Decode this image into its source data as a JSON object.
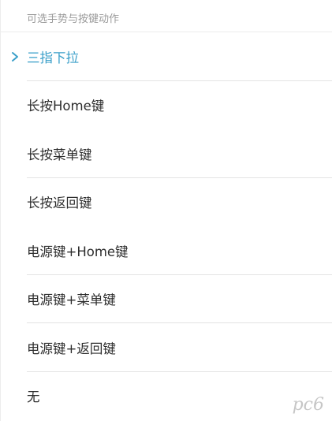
{
  "header": {
    "title": "可选手势与按键动作"
  },
  "options": [
    {
      "label": "三指下拉",
      "selected": true
    },
    {
      "label": "长按Home键",
      "selected": false
    },
    {
      "label": "长按菜单键",
      "selected": false
    },
    {
      "label": "长按返回键",
      "selected": false
    },
    {
      "label": "电源键+Home键",
      "selected": false
    },
    {
      "label": "电源键+菜单键",
      "selected": false
    },
    {
      "label": "电源键+返回键",
      "selected": false
    },
    {
      "label": "无",
      "selected": false
    }
  ],
  "watermark": {
    "logo": "pc6"
  },
  "colors": {
    "accent": "#3a9fc9",
    "text": "#2d2d2d",
    "header_text": "#9a9a9a",
    "divider": "#e3e3e3"
  }
}
